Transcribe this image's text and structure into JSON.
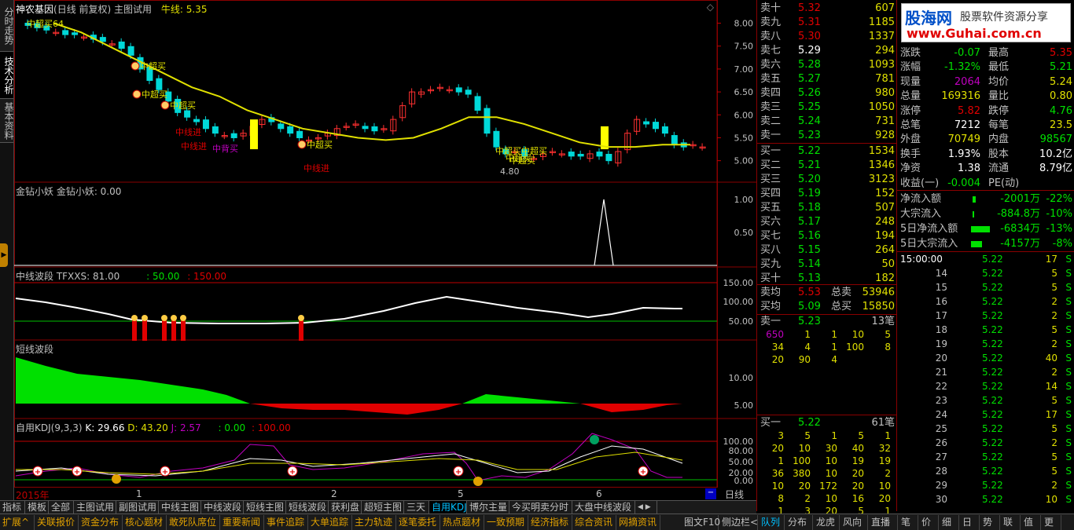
{
  "left_tabs": [
    "分时走势",
    "技术分析",
    "基本资料"
  ],
  "chart": {
    "title": "神农基因",
    "period": "(日线 前复权)",
    "template": "主图试用",
    "ma_label": "牛线: 5.35",
    "annotation_start": "中超买64",
    "price_axis": [
      "8.00",
      "7.50",
      "7.00",
      "6.50",
      "6.00",
      "5.50",
      "5.00"
    ],
    "low_label": "4.80",
    "signal_labels": [
      "中超买",
      "中超买",
      "中超买",
      "中线进",
      "中线进",
      "中背买",
      "中超买",
      "中线进",
      "中超买中超买",
      "中超买",
      "中超买"
    ],
    "panel2_title": "金钻小妖  金钻小妖: 0.00",
    "panel2_axis": [
      "1.00",
      "0.50"
    ],
    "panel3_title": "中线波段  TFXXS: 81.00",
    "panel3_v1": ": 50.00",
    "panel3_v2": ": 150.00",
    "panel3_axis": [
      "150.00",
      "100.00",
      "50.00"
    ],
    "panel4_title": "短线波段",
    "panel4_axis": [
      "10.00",
      "5.00"
    ],
    "panel5_title": "自用KDJ(9,3,3)",
    "panel5_k": "K: 29.66",
    "panel5_d": "D: 43.20",
    "panel5_j": "J: 2.57",
    "panel5_v1": ": 0.00",
    "panel5_v2": ": 100.00",
    "panel5_axis": [
      "100.00",
      "80.00",
      "50.00",
      "20.00",
      "0.00"
    ],
    "time_axis": [
      "2015年",
      "1",
      "2",
      "5",
      "6"
    ],
    "period_button": "日线"
  },
  "chart_data": {
    "type": "candlestick",
    "ylim": [
      4.6,
      8.3
    ],
    "ma": [
      8.0,
      7.8,
      7.5,
      7.2,
      6.9,
      6.6,
      6.4,
      6.1,
      5.9,
      5.7,
      5.6,
      5.5,
      5.45,
      5.5,
      5.7,
      5.95,
      5.95,
      5.8,
      5.6,
      5.4,
      5.3,
      5.3,
      5.35,
      5.35
    ]
  },
  "order_book": {
    "asks": [
      {
        "label": "卖十",
        "price": "5.32",
        "vol": "607"
      },
      {
        "label": "卖九",
        "price": "5.31",
        "vol": "1185"
      },
      {
        "label": "卖八",
        "price": "5.30",
        "vol": "1337"
      },
      {
        "label": "卖七",
        "price": "5.29",
        "vol": "294"
      },
      {
        "label": "卖六",
        "price": "5.28",
        "vol": "1093"
      },
      {
        "label": "卖五",
        "price": "5.27",
        "vol": "781"
      },
      {
        "label": "卖四",
        "price": "5.26",
        "vol": "980"
      },
      {
        "label": "卖三",
        "price": "5.25",
        "vol": "1050"
      },
      {
        "label": "卖二",
        "price": "5.24",
        "vol": "731"
      },
      {
        "label": "卖一",
        "price": "5.23",
        "vol": "928"
      }
    ],
    "bids": [
      {
        "label": "买一",
        "price": "5.22",
        "vol": "1534"
      },
      {
        "label": "买二",
        "price": "5.21",
        "vol": "1346"
      },
      {
        "label": "买三",
        "price": "5.20",
        "vol": "3123"
      },
      {
        "label": "买四",
        "price": "5.19",
        "vol": "152"
      },
      {
        "label": "买五",
        "price": "5.18",
        "vol": "507"
      },
      {
        "label": "买六",
        "price": "5.17",
        "vol": "248"
      },
      {
        "label": "买七",
        "price": "5.16",
        "vol": "194"
      },
      {
        "label": "买八",
        "price": "5.15",
        "vol": "264"
      },
      {
        "label": "买九",
        "price": "5.14",
        "vol": "50"
      },
      {
        "label": "买十",
        "price": "5.13",
        "vol": "182"
      }
    ],
    "avg_sell_label": "卖均",
    "avg_sell": "5.53",
    "total_sell_label": "总卖",
    "total_sell": "53946",
    "avg_buy_label": "买均",
    "avg_buy": "5.09",
    "total_buy_label": "总买",
    "total_buy": "15850",
    "ask1_queue_label": "卖一",
    "ask1_queue_price": "5.23",
    "ask1_queue_count": "13笔",
    "ask1_queue": [
      [
        "650",
        "1",
        "1",
        "10",
        "5"
      ],
      [
        "34",
        "4",
        "1",
        "100",
        "8"
      ],
      [
        "20",
        "90",
        "4",
        "",
        ""
      ]
    ],
    "bid1_queue_label": "买一",
    "bid1_queue_price": "5.22",
    "bid1_queue_count": "61笔",
    "bid1_queue": [
      [
        "3",
        "5",
        "1",
        "5",
        "1"
      ],
      [
        "20",
        "10",
        "30",
        "40",
        "32"
      ],
      [
        "1",
        "100",
        "10",
        "19",
        "19"
      ],
      [
        "36",
        "380",
        "10",
        "20",
        "2"
      ],
      [
        "10",
        "20",
        "172",
        "20",
        "10"
      ],
      [
        "8",
        "2",
        "10",
        "16",
        "20"
      ],
      [
        "1",
        "3",
        "20",
        "5",
        "1"
      ]
    ]
  },
  "logo": {
    "name": "股海网",
    "slogan": "股票软件资源分享",
    "url": "www.Guhai.com.cn"
  },
  "stats": [
    {
      "k1": "涨跌",
      "v1": "-0.07",
      "k2": "最高",
      "v2": "5.35"
    },
    {
      "k1": "涨幅",
      "v1": "-1.32%",
      "k2": "最低",
      "v2": "5.21"
    },
    {
      "k1": "现量",
      "v1": "2064",
      "k2": "均价",
      "v2": "5.24"
    },
    {
      "k1": "总量",
      "v1": "169316",
      "k2": "量比",
      "v2": "0.80"
    },
    {
      "k1": "涨停",
      "v1": "5.82",
      "k2": "跌停",
      "v2": "4.76"
    },
    {
      "k1": "总笔",
      "v1": "7212",
      "k2": "每笔",
      "v2": "23.5"
    },
    {
      "k1": "外盘",
      "v1": "70749",
      "k2": "内盘",
      "v2": "98567"
    },
    {
      "k1": "换手",
      "v1": "1.93%",
      "k2": "股本",
      "v2": "10.2亿"
    },
    {
      "k1": "净资",
      "v1": "1.38",
      "k2": "流通",
      "v2": "8.79亿"
    },
    {
      "k1": "收益(一)",
      "v1": "-0.004",
      "k2": "PE(动)",
      "v2": ""
    }
  ],
  "flows": [
    {
      "label": "净流入额",
      "value": "-2001万",
      "pct": "-22%"
    },
    {
      "label": "大宗流入",
      "value": "-884.8万",
      "pct": "-10%"
    },
    {
      "label": "5日净流入额",
      "value": "-6834万",
      "pct": "-13%"
    },
    {
      "label": "5日大宗流入",
      "value": "-4157万",
      "pct": "-8%"
    }
  ],
  "ticks": [
    {
      "t": "15:00:00",
      "p": "5.22",
      "v": "17",
      "s": "S"
    },
    {
      "t": "14",
      "p": "5.22",
      "v": "5",
      "s": "S"
    },
    {
      "t": "15",
      "p": "5.22",
      "v": "5",
      "s": "S"
    },
    {
      "t": "16",
      "p": "5.22",
      "v": "2",
      "s": "S"
    },
    {
      "t": "17",
      "p": "5.22",
      "v": "2",
      "s": "S"
    },
    {
      "t": "18",
      "p": "5.22",
      "v": "5",
      "s": "S"
    },
    {
      "t": "19",
      "p": "5.22",
      "v": "2",
      "s": "S"
    },
    {
      "t": "20",
      "p": "5.22",
      "v": "40",
      "s": "S"
    },
    {
      "t": "21",
      "p": "5.22",
      "v": "2",
      "s": "S"
    },
    {
      "t": "22",
      "p": "5.22",
      "v": "14",
      "s": "S"
    },
    {
      "t": "23",
      "p": "5.22",
      "v": "5",
      "s": "S"
    },
    {
      "t": "24",
      "p": "5.22",
      "v": "17",
      "s": "S"
    },
    {
      "t": "25",
      "p": "5.22",
      "v": "5",
      "s": "S"
    },
    {
      "t": "26",
      "p": "5.22",
      "v": "2",
      "s": "S"
    },
    {
      "t": "27",
      "p": "5.22",
      "v": "5",
      "s": "S"
    },
    {
      "t": "28",
      "p": "5.22",
      "v": "5",
      "s": "S"
    },
    {
      "t": "29",
      "p": "5.22",
      "v": "2",
      "s": "S"
    },
    {
      "t": "30",
      "p": "5.22",
      "v": "10",
      "s": "S"
    }
  ],
  "bottom_tabs": [
    "指标",
    "模板",
    "全部",
    "主图试用",
    "副图试用",
    "中线主图",
    "中线波段",
    "短线主图",
    "短线波段",
    "获利盘",
    "超短主图",
    "三天",
    "自用KDJ",
    "博尔主量",
    "今买明卖分时",
    "大盘中线波段"
  ],
  "menu_tabs": [
    "扩展^",
    "关联报价",
    "资金分布",
    "核心题材",
    "敢死队席位",
    "重要新闻",
    "事件追踪",
    "大单追踪",
    "主力轨迹",
    "逐笔委托",
    "热点题材",
    "一致预期",
    "经济指标",
    "综合资讯",
    "网摘资讯"
  ],
  "right_tabs": [
    "图文F10",
    "侧边栏<",
    "队列",
    "分布",
    "龙虎",
    "风向",
    "直播",
    "笔",
    "价",
    "细",
    "日",
    "势",
    "联",
    "值",
    "更"
  ]
}
